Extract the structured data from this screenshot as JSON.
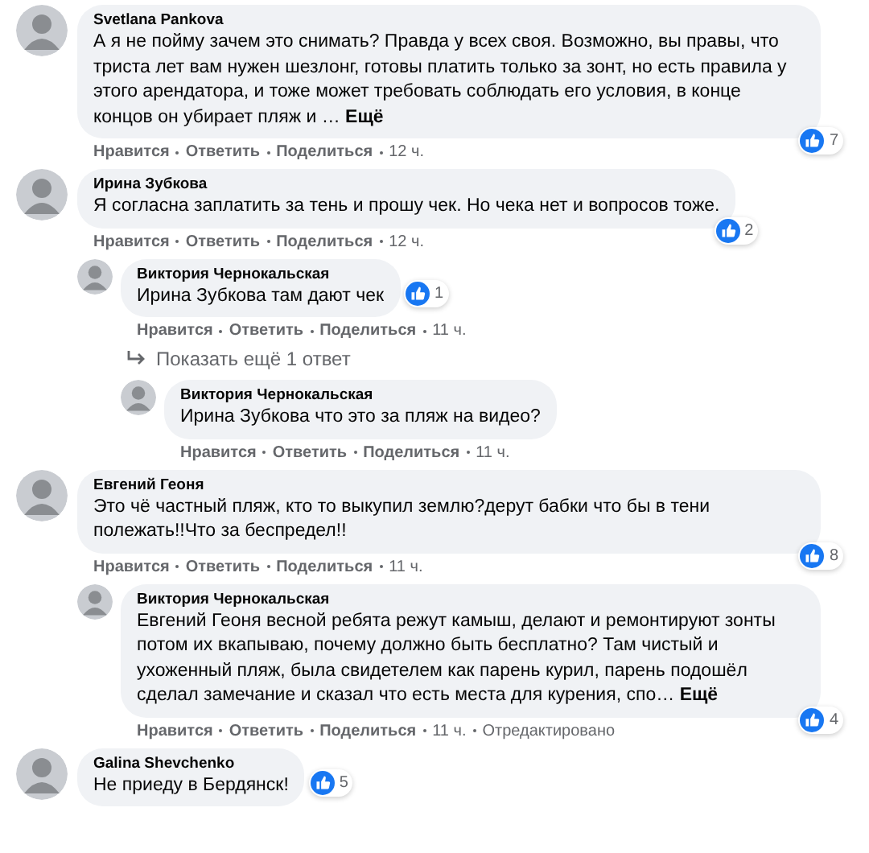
{
  "comments": [
    {
      "author": "Svetlana Pankova",
      "text": "А я не пойму зачем это снимать? Правда у всех своя. Возможно, вы правы, что триста лет вам нужен шезлонг, готовы платить только за зонт, но есть правила у этого арендатора, и тоже может требовать соблюдать его условия, в конце концов он убирает пляж и …",
      "more": "Ещё",
      "reactions": "7",
      "actions": [
        "Нравится",
        "Ответить",
        "Поделиться"
      ],
      "time": "12 ч."
    },
    {
      "author": "Ирина Зубкова",
      "text": "Я согласна заплатить за тень и прошу чек. Но чека нет и вопросов тоже.",
      "reactions": "2",
      "actions": [
        "Нравится",
        "Ответить",
        "Поделиться"
      ],
      "time": "12 ч.",
      "replies": [
        {
          "author": "Виктория Чернокальская",
          "text": "Ирина Зубкова там дают чек",
          "reactions": "1",
          "actions": [
            "Нравится",
            "Ответить",
            "Поделиться"
          ],
          "time": "11 ч.",
          "more_replies": "Показать ещё 1 ответ",
          "replies": [
            {
              "author": "Виктория Чернокальская",
              "text": "Ирина Зубкова что это за пляж на видео?",
              "actions": [
                "Нравится",
                "Ответить",
                "Поделиться"
              ],
              "time": "11 ч."
            }
          ]
        }
      ]
    },
    {
      "author": "Евгений Геоня",
      "text": "Это чё частный пляж, кто то выкупил землю?дерут бабки что бы в тени полежать!!Что за беспредел!!",
      "reactions": "8",
      "actions": [
        "Нравится",
        "Ответить",
        "Поделиться"
      ],
      "time": "11 ч.",
      "replies": [
        {
          "author": "Виктория Чернокальская",
          "text": "Евгений Геоня весной ребята режут камыш, делают и ремонтируют зонты потом их вкапываю, почему должно быть бесплатно? Там чистый и ухоженный пляж, была свидетелем как парень курил, парень подошёл сделал замечание и сказал что есть места для курения, спо…",
          "more": "Ещё",
          "reactions": "4",
          "actions": [
            "Нравится",
            "Ответить",
            "Поделиться"
          ],
          "time": "11 ч.",
          "edited": "Отредактировано"
        }
      ]
    },
    {
      "author": "Galina Shevchenko",
      "text": "Не приеду в Бердянск!",
      "reactions": "5"
    }
  ]
}
